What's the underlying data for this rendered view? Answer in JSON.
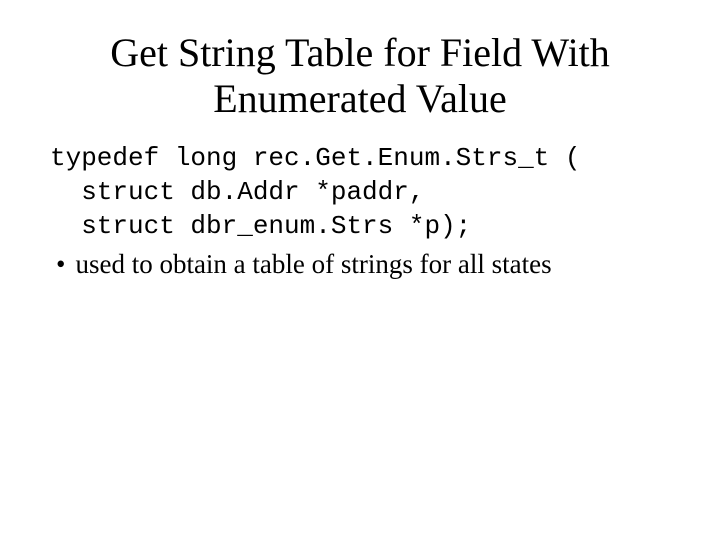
{
  "title_line1": "Get String Table for Field With",
  "title_line2": "Enumerated Value",
  "code_line1": "typedef long rec.Get.Enum.Strs_t (",
  "code_line2": "  struct db.Addr *paddr,",
  "code_line3": "  struct dbr_enum.Strs *p);",
  "bullet_dot": "•",
  "bullet_text": "used to obtain a table of strings for all states"
}
